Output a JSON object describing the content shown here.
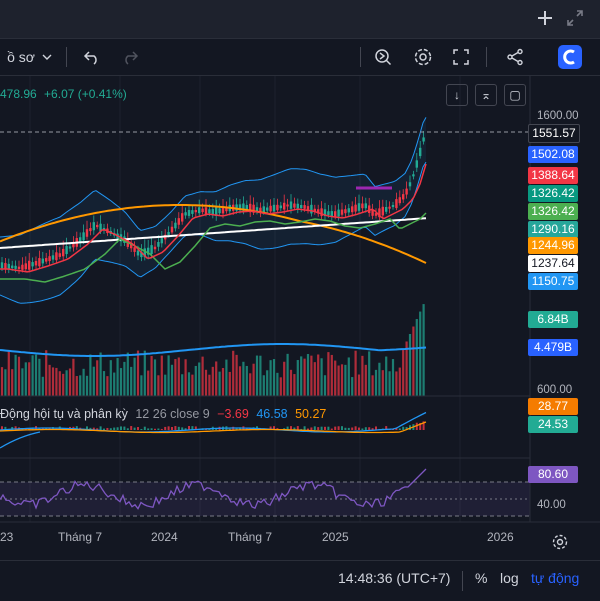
{
  "top": {
    "plus_icon": "plus-icon",
    "expand_icon": "expand-icon"
  },
  "toolbar": {
    "chart_type_label": "ồ sơ"
  },
  "legend": {
    "price": "478.96",
    "change": "+6.07 (+0.41%)",
    "macd_title": "Động hội tụ và phân kỳ",
    "macd_params": "12 26 close 9",
    "macd_v1": "−3.69",
    "macd_v2": "46.58",
    "macd_v3": "50.27"
  },
  "price_axis": {
    "ticks": {
      "top": "1600.00",
      "vol": "600.00",
      "rsi": "40.00"
    },
    "badges": [
      {
        "value": "1551.57",
        "color": "#131722"
      },
      {
        "value": "1502.08",
        "color": "#2962ff"
      },
      {
        "value": "1388.64",
        "color": "#f23645"
      },
      {
        "value": "1326.42",
        "color": "#089981"
      },
      {
        "value": "1326.42",
        "color": "#4caf50"
      },
      {
        "value": "1290.16",
        "color": "#26a69a"
      },
      {
        "value": "1244.96",
        "color": "#ff9800"
      },
      {
        "value": "1237.64",
        "color": "#ffffff"
      },
      {
        "value": "1150.75",
        "color": "#2196f3"
      },
      {
        "value": "6.84B",
        "color": "#22ab94"
      },
      {
        "value": "4.479B",
        "color": "#2962ff"
      },
      {
        "value": "28.77",
        "color": "#f57c00"
      },
      {
        "value": "24.53",
        "color": "#22ab94"
      },
      {
        "value": "80.60",
        "color": "#7e57c2"
      }
    ]
  },
  "time_axis": [
    "23",
    "Tháng 7",
    "2024",
    "Tháng 7",
    "2025",
    "2026"
  ],
  "bottom": {
    "time": "14:48:36 (UTC+7)",
    "percent": "%",
    "log": "log",
    "auto": "tự động"
  }
}
